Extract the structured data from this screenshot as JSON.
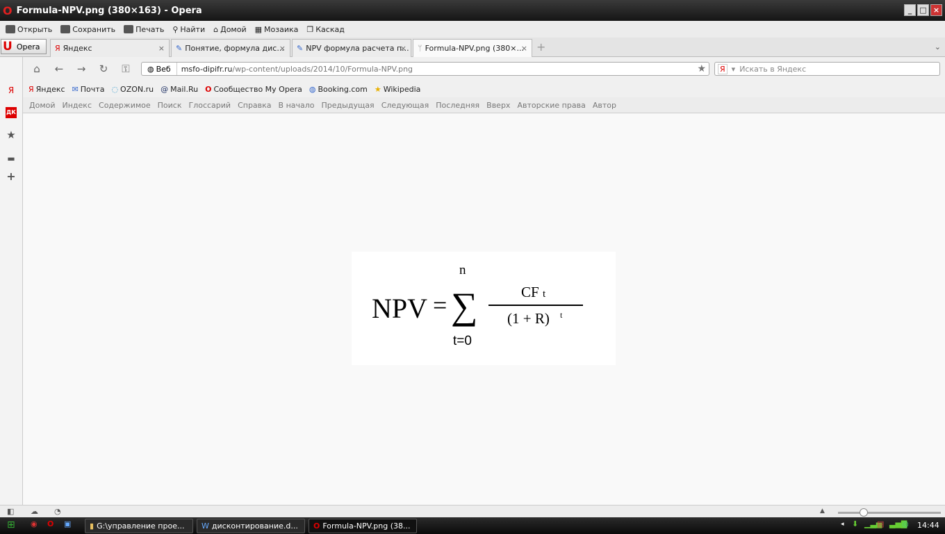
{
  "window": {
    "title": "Formula-NPV.png (380×163) - Opera"
  },
  "menu": [
    "Открыть",
    "Сохранить",
    "Печать",
    "Найти",
    "Домой",
    "Мозаика",
    "Каскад"
  ],
  "opera_button": "Opera",
  "tabs": [
    {
      "label": "Яндекс",
      "icon": "yandex-icon"
    },
    {
      "label": "Понятие, формула дис...",
      "icon": "document-icon"
    },
    {
      "label": "NPV формула расчета п...",
      "icon": "document-icon"
    },
    {
      "label": "Formula-NPV.png (380×...",
      "icon": "image-icon",
      "active": true
    }
  ],
  "address": {
    "web_label": "Веб",
    "host": "msfo-dipifr.ru",
    "path": "/wp-content/uploads/2014/10/Formula-NPV.png"
  },
  "search": {
    "placeholder": "Искать в Яндекс",
    "engine": "Я"
  },
  "bookmarks": [
    "Яндекс",
    "Почта",
    "OZON.ru",
    "Mail.Ru",
    "Сообщество My Opera",
    "Booking.com",
    "Wikipedia"
  ],
  "navlinks": [
    "Домой",
    "Индекс",
    "Содержимое",
    "Поиск",
    "Глоссарий",
    "Справка",
    "В начало",
    "Предыдущая",
    "Следующая",
    "Последняя",
    "Вверх",
    "Авторские права",
    "Автор"
  ],
  "sidepanel": [
    "Я",
    "ДК"
  ],
  "formula": {
    "lhs": "NPV",
    "eq": "=",
    "sigma": "∑",
    "upper": "n",
    "lower": "t=0",
    "numerator": "CF",
    "num_sub": "t",
    "denominator": "(1 + R)",
    "den_sup": "t"
  },
  "taskbar": {
    "items": [
      "G:\\управление прое...",
      "дисконтирование.d...",
      "Formula-NPV.png (38..."
    ],
    "clock": "14:44"
  },
  "zoom_slider": 0.25
}
